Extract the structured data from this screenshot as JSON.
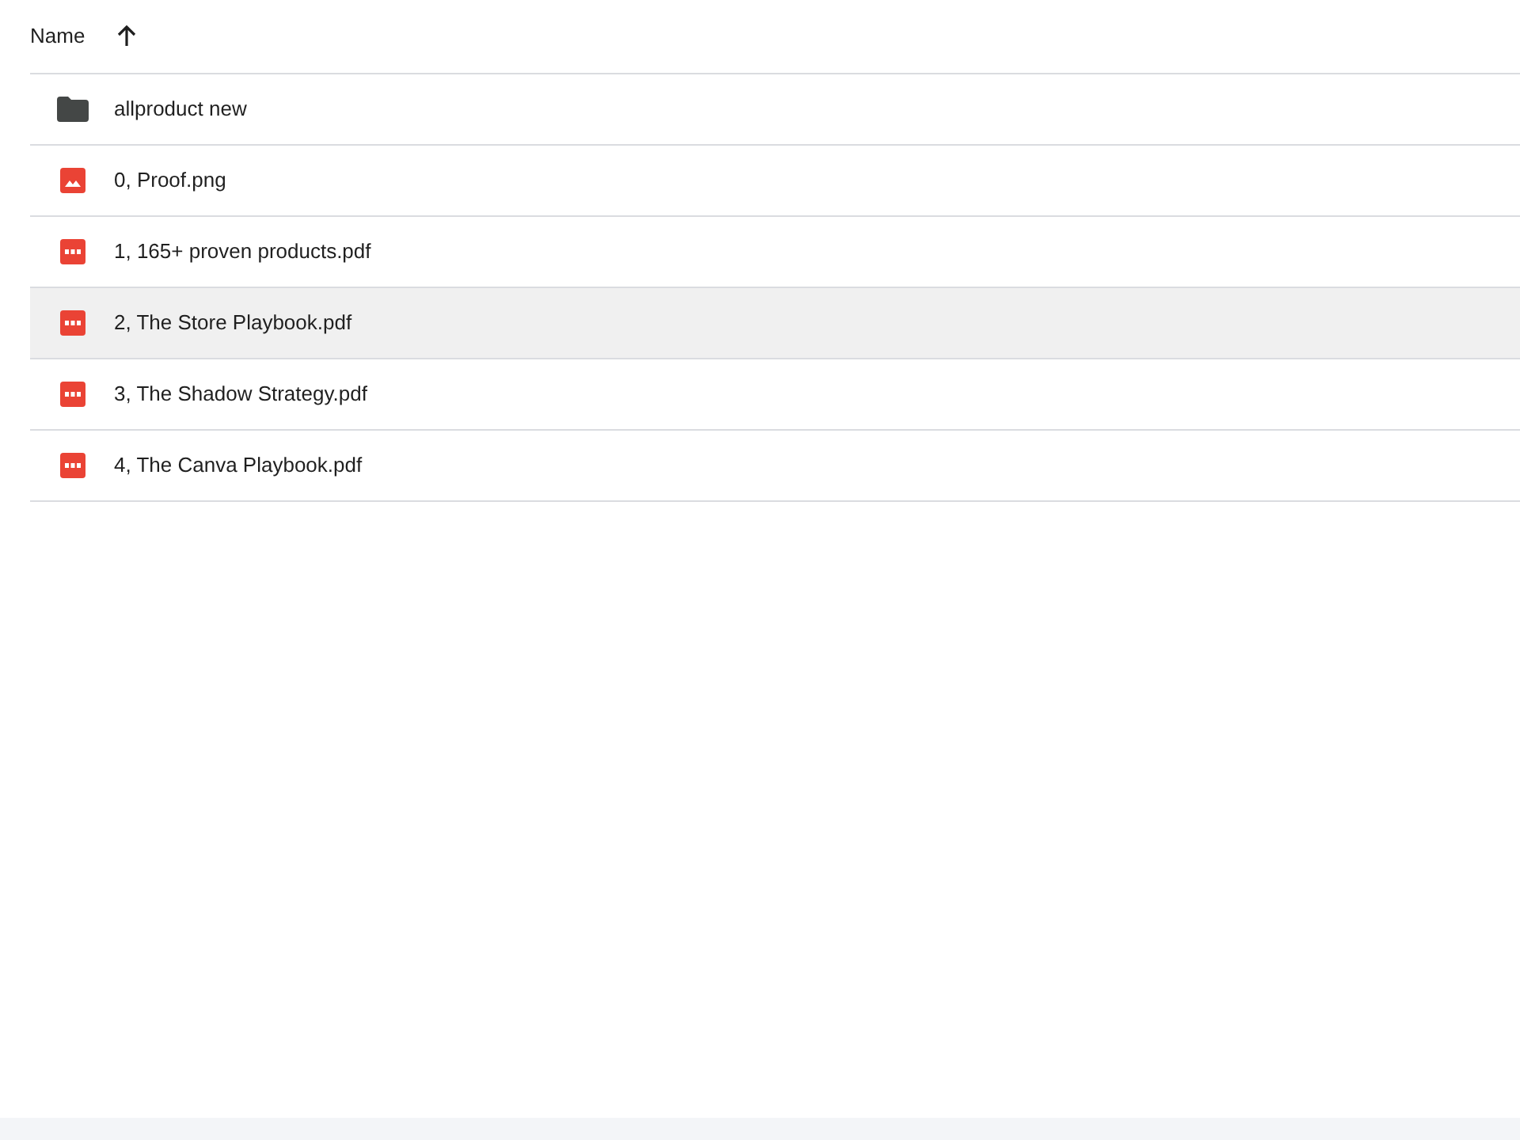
{
  "header": {
    "column": "Name",
    "sort_ascending": true
  },
  "files": [
    {
      "name": "allproduct new",
      "kind": "folder",
      "selected": false
    },
    {
      "name": "0, Proof.png",
      "kind": "image",
      "selected": false
    },
    {
      "name": "1, 165+ proven products.pdf",
      "kind": "pdf",
      "selected": false
    },
    {
      "name": "2, The Store Playbook.pdf",
      "kind": "pdf",
      "selected": true
    },
    {
      "name": "3, The Shadow Strategy.pdf",
      "kind": "pdf",
      "selected": false
    },
    {
      "name": "4, The Canva Playbook.pdf",
      "kind": "pdf",
      "selected": false
    }
  ]
}
